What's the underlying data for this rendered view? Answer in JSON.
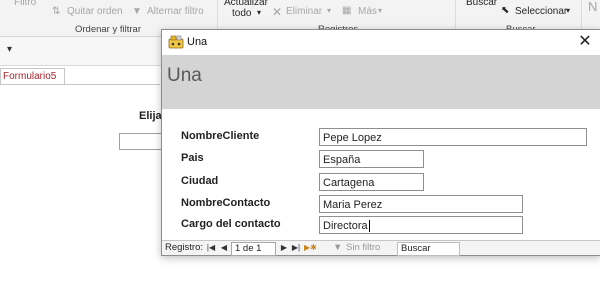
{
  "ribbon": {
    "filter_label": "Filtro",
    "remove_sort_label": "Quitar orden",
    "toggle_filter_label": "Alternar filtro",
    "sort_filter_group": "Ordenar y filtrar",
    "refresh_label_line1": "Actualizar",
    "refresh_label_line2": "todo",
    "delete_label": "Eliminar",
    "more_label": "Más",
    "records_group": "Registros",
    "find_label": "Buscar",
    "select_label": "Seleccionar",
    "find_group": "Buscar"
  },
  "quick_access": {
    "arrow": "▾"
  },
  "document_tab": {
    "label": "Formulario5"
  },
  "background_form": {
    "prompt_label": "Elija"
  },
  "dialog": {
    "title": "Una",
    "header_title": "Una",
    "close_glyph": "✕",
    "fields": [
      {
        "label": "NombreCliente",
        "value": "Pepe Lopez"
      },
      {
        "label": "Pais",
        "value": "España"
      },
      {
        "label": "Ciudad",
        "value": "Cartagena"
      },
      {
        "label": "NombreContacto",
        "value": "Maria Perez"
      },
      {
        "label": "Cargo del contacto",
        "value": "Directora"
      }
    ]
  },
  "record_nav": {
    "label": "Registro:",
    "first_icon": "first-record-icon",
    "prev_icon": "previous-record-icon",
    "position": "1 de 1",
    "next_icon": "next-record-icon",
    "last_icon": "last-record-icon",
    "new_icon": "new-record-icon",
    "filter_status": "Sin filtro",
    "search_placeholder": "Buscar"
  }
}
